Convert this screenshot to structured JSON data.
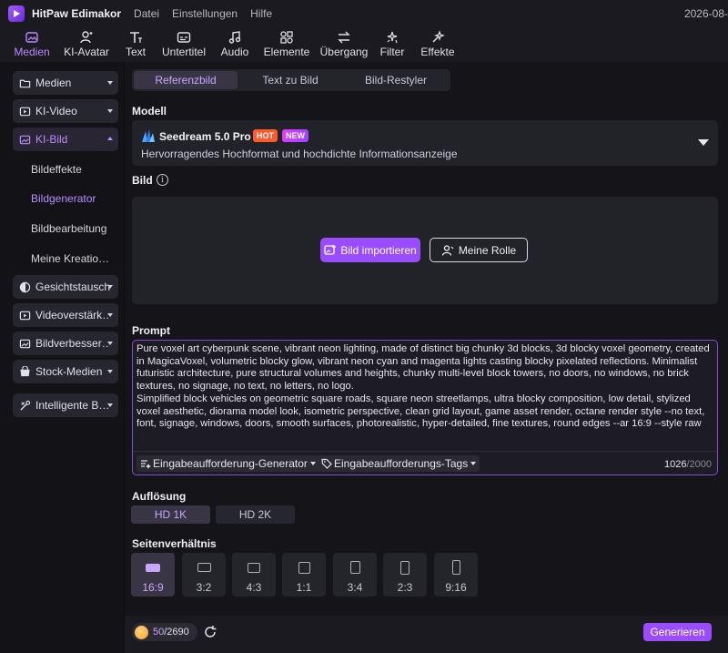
{
  "titlebar": {
    "app_name": "HitPaw Edimakor",
    "menus": [
      "Datei",
      "Einstellungen",
      "Hilfe"
    ],
    "date": "2026-08-"
  },
  "toolbar": {
    "items": [
      {
        "label": "Medien",
        "icon": "media-icon",
        "active": true
      },
      {
        "label": "KI-Avatar",
        "icon": "avatar-icon",
        "active": false
      },
      {
        "label": "Text",
        "icon": "text-icon",
        "active": false
      },
      {
        "label": "Untertitel",
        "icon": "subtitle-icon",
        "active": false
      },
      {
        "label": "Audio",
        "icon": "audio-icon",
        "active": false
      },
      {
        "label": "Elemente",
        "icon": "elements-icon",
        "active": false
      },
      {
        "label": "Übergang",
        "icon": "transition-icon",
        "active": false
      },
      {
        "label": "Filter",
        "icon": "filter-icon",
        "active": false
      },
      {
        "label": "Effekte",
        "icon": "effects-icon",
        "active": false
      }
    ]
  },
  "sidebar": {
    "items": [
      {
        "label": "Medien",
        "icon": "folder-icon"
      },
      {
        "label": "KI-Video",
        "icon": "video-icon"
      },
      {
        "label": "KI-Bild",
        "icon": "image-ai-icon",
        "active": true
      },
      {
        "label": "Gesichtstausch",
        "icon": "face-swap-icon"
      },
      {
        "label": "Videoverstärk…",
        "icon": "video-enhance-icon"
      },
      {
        "label": "Bildverbesser…",
        "icon": "image-enhance-icon"
      },
      {
        "label": "Stock-Medien",
        "icon": "stock-icon"
      },
      {
        "label": "Intelligente B…",
        "icon": "smart-tools-icon"
      }
    ],
    "subitems": [
      {
        "label": "Bildeffekte"
      },
      {
        "label": "Bildgenerator",
        "active": true
      },
      {
        "label": "Bildbearbeitung"
      },
      {
        "label": "Meine Kreatio…"
      }
    ]
  },
  "main": {
    "tabs": [
      "Referenzbild",
      "Text zu Bild",
      "Bild-Restyler"
    ],
    "model_label": "Modell",
    "model": {
      "name": "Seedream 5.0 Pro",
      "badge_hot": "HOT",
      "badge_new": "NEW",
      "description": "Hervorragendes Hochformat und hochdichte Informationsanzeige"
    },
    "image_label": "Bild",
    "import_button": "Bild importieren",
    "role_button": "Meine Rolle",
    "prompt_label": "Prompt",
    "prompt_text": "Pure voxel art cyberpunk scene, vibrant neon lighting, made of distinct big chunky 3d blocks, 3d blocky voxel geometry, created in MagicaVoxel, volumetric blocky glow, vibrant neon cyan and magenta lights casting blocky pixelated reflections. Minimalist futuristic architecture, pure structural volumes and heights, chunky multi-level block towers, no doors, no windows, no brick textures, no signage, no text, no letters, no logo.\nSimplified block vehicles on geometric square roads, square neon streetlamps, ultra blocky composition, low detail, stylized voxel aesthetic, diorama model look, isometric perspective, clean grid layout, game asset render, octane render style --no text, font, signage, windows, doors, smooth surfaces, photorealistic, hyper-detailed, fine textures, round edges --ar 16:9 --style raw",
    "prompt_generator": "Eingabeaufforderung-Generator",
    "prompt_tags": "Eingabeaufforderungs-Tags",
    "char_count": "1026",
    "char_max": "/2000",
    "resolution_label": "Auflösung",
    "resolutions": [
      "HD 1K",
      "HD 2K"
    ],
    "aspect_label": "Seitenverhältnis",
    "aspects": [
      "16:9",
      "3:2",
      "4:3",
      "1:1",
      "3:4",
      "2:3",
      "9:16"
    ]
  },
  "footer": {
    "credits_used": "50",
    "credits_total": "/2690",
    "generate_button": "Generieren"
  },
  "colors": {
    "accent": "#9a4cff",
    "accent_text": "#c9a6ff",
    "hot": "#ff5a2c"
  }
}
